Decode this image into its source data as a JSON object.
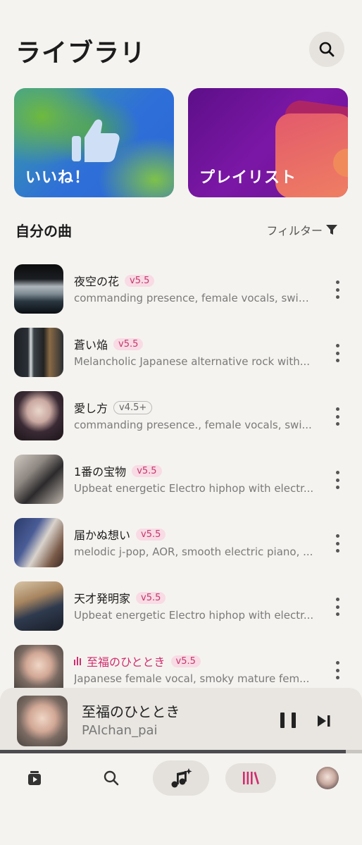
{
  "header": {
    "title": "ライブラリ",
    "search_icon": "search-icon"
  },
  "cards": [
    {
      "label": "いいね！",
      "icon": "thumbs-up-icon"
    },
    {
      "label": "プレイリスト"
    }
  ],
  "section": {
    "title": "自分の曲",
    "filter_label": "フィルター",
    "filter_icon": "funnel-icon"
  },
  "songs": [
    {
      "title": "夜空の花",
      "version": "v5.5",
      "desc": "commanding presence, female vocals, swin..."
    },
    {
      "title": "蒼い焔",
      "version": "v5.5",
      "desc": "Melancholic Japanese alternative rock with..."
    },
    {
      "title": "愛し方",
      "version": "v4.5+",
      "desc": "commanding presence., female vocals, swi..."
    },
    {
      "title": "1番の宝物",
      "version": "v5.5",
      "desc": "Upbeat energetic Electro hiphop with electr..."
    },
    {
      "title": "届かぬ想い",
      "version": "v5.5",
      "desc": "melodic j-pop, AOR, smooth electric piano, ..."
    },
    {
      "title": "天才発明家",
      "version": "v5.5",
      "desc": "Upbeat energetic Electro hiphop with electr..."
    },
    {
      "title": "至福のひととき",
      "version": "v5.5",
      "desc": "Japanese female vocal, smoky mature fem...",
      "playing": true
    }
  ],
  "player": {
    "title": "至福のひととき",
    "artist": "PAIchan_pai",
    "progress_fraction": 0.955
  },
  "nav": [
    "home-icon",
    "search-icon",
    "create-icon",
    "library-icon",
    "profile-avatar"
  ],
  "colors": {
    "accent": "#d02d6e",
    "badge_bg": "#f8dbe5",
    "background": "#f5f3ef"
  }
}
